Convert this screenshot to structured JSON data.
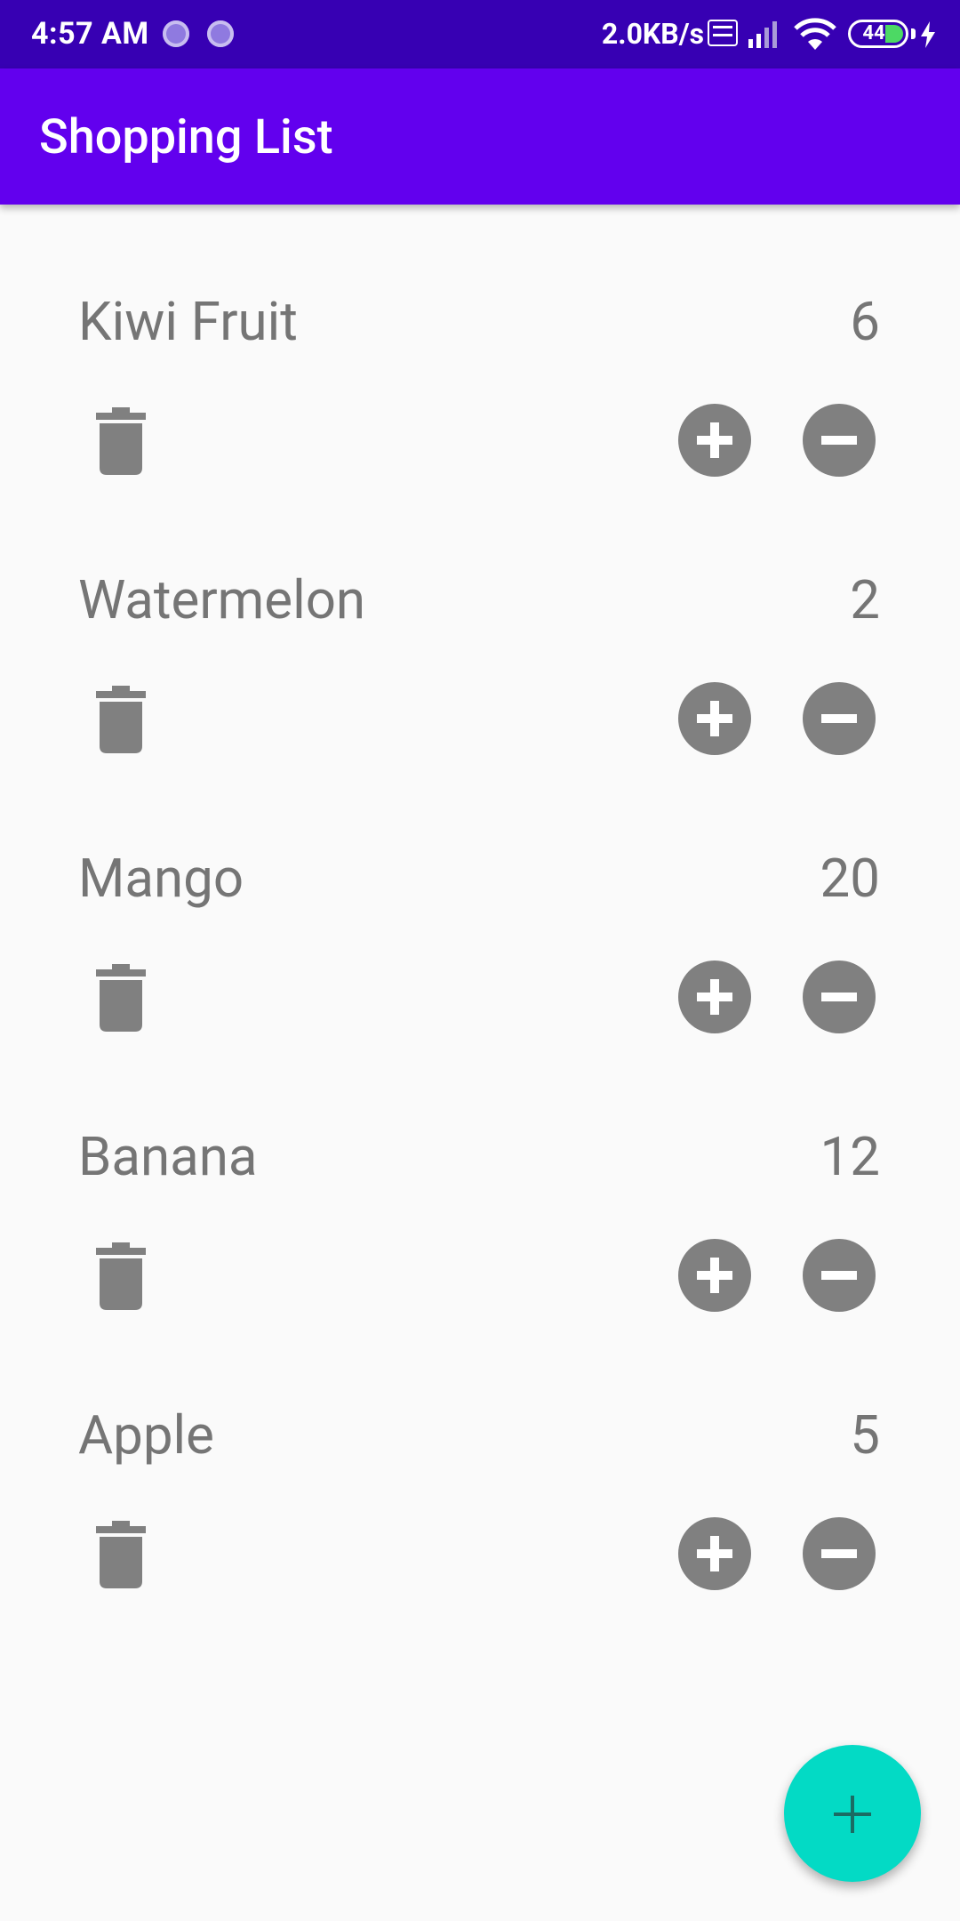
{
  "status_bar": {
    "time": "4:57 AM",
    "network_speed": "2.0KB/s",
    "battery_level": "44",
    "icons": [
      "notification-dot-icon",
      "notification-dot-icon",
      "volte-icon",
      "signal-icon",
      "wifi-icon",
      "battery-icon",
      "charging-bolt-icon"
    ]
  },
  "app_bar": {
    "title": "Shopping List"
  },
  "items": [
    {
      "name": "Kiwi Fruit",
      "quantity": "6"
    },
    {
      "name": "Watermelon",
      "quantity": "2"
    },
    {
      "name": "Mango",
      "quantity": "20"
    },
    {
      "name": "Banana",
      "quantity": "12"
    },
    {
      "name": "Apple",
      "quantity": "5"
    }
  ],
  "row_icons": {
    "delete": "trash-icon",
    "increment": "plus-circle-icon",
    "decrement": "minus-circle-icon"
  },
  "fab": {
    "icon": "plus-icon"
  },
  "colors": {
    "status_bar": "#3700b3",
    "app_bar": "#6200ee",
    "fab": "#03dac5",
    "icon_gray": "#808080",
    "text_gray": "#757575",
    "background": "#fafafa"
  }
}
